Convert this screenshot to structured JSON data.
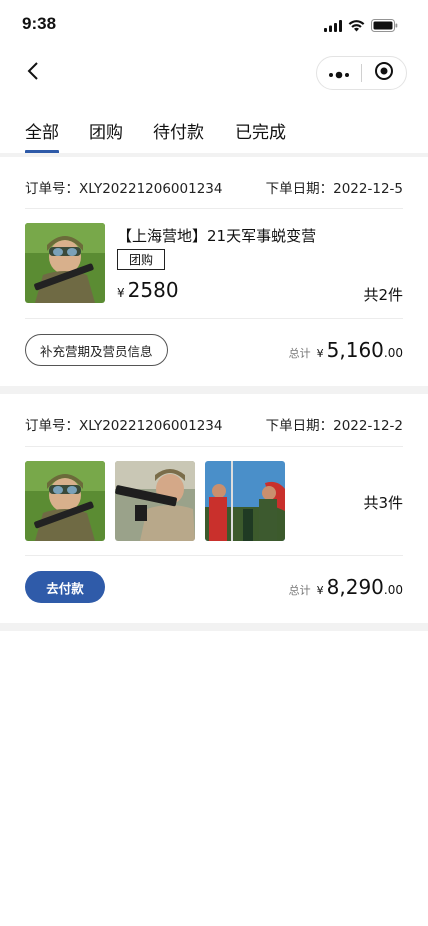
{
  "status": {
    "time": "9:38"
  },
  "tabs": [
    {
      "label": "全部"
    },
    {
      "label": "团购"
    },
    {
      "label": "待付款"
    },
    {
      "label": "已完成"
    }
  ],
  "orders": [
    {
      "order_no": "订单号：XLY20221206001234",
      "order_date": "下单日期：2022-12-5",
      "product_title": "【上海营地】21天军事蜕变营",
      "tag": "团购",
      "price_currency": "¥",
      "price": "2580",
      "count": "共2件",
      "action_label": "补充营期及营员信息",
      "total_label": "总计",
      "total_currency": "¥",
      "total_int": "5,160",
      "total_dec": ".00"
    },
    {
      "order_no": "订单号：XLY20221206001234",
      "order_date": "下单日期：2022-12-2",
      "count": "共3件",
      "action_label": "去付款",
      "total_label": "总计",
      "total_currency": "¥",
      "total_int": "8,290",
      "total_dec": ".00"
    }
  ],
  "colors": {
    "accent": "#2e5aa8",
    "pay_button": "#2f5ba9",
    "divider": "#f2f2f2"
  }
}
